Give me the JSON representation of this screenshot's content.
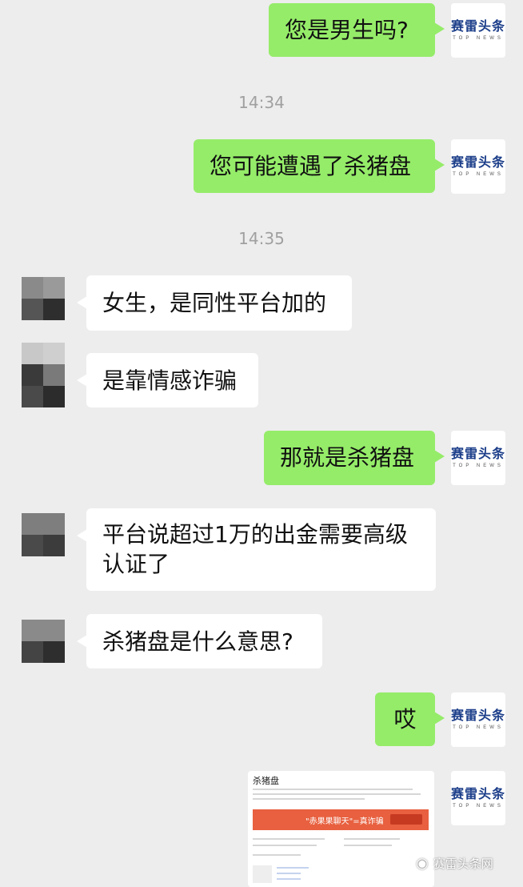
{
  "avatar_brand": {
    "name": "赛雷头条",
    "sub": "TOP NEWS"
  },
  "messages": [
    {
      "from": "me",
      "text": "您是男生吗?"
    },
    {
      "type": "time",
      "text": "14:34"
    },
    {
      "from": "me",
      "text": "您可能遭遇了杀猪盘"
    },
    {
      "type": "time",
      "text": "14:35"
    },
    {
      "from": "other",
      "text": "女生，是同性平台加的"
    },
    {
      "from": "other",
      "text": "是靠情感诈骗"
    },
    {
      "from": "me",
      "text": "那就是杀猪盘"
    },
    {
      "from": "other",
      "text": "平台说超过1万的出金需要高级认证了"
    },
    {
      "from": "other",
      "text": "杀猪盘是什么意思?"
    },
    {
      "from": "me",
      "text": "哎"
    },
    {
      "from": "me",
      "type": "image",
      "title": "杀猪盘",
      "banner_text": "\"赤果果聊天\"=真诈骗"
    }
  ],
  "watermark": "赛雷头条网",
  "colors": {
    "bubble_me": "#95ec69",
    "bubble_other": "#ffffff",
    "bg": "#ededed"
  }
}
